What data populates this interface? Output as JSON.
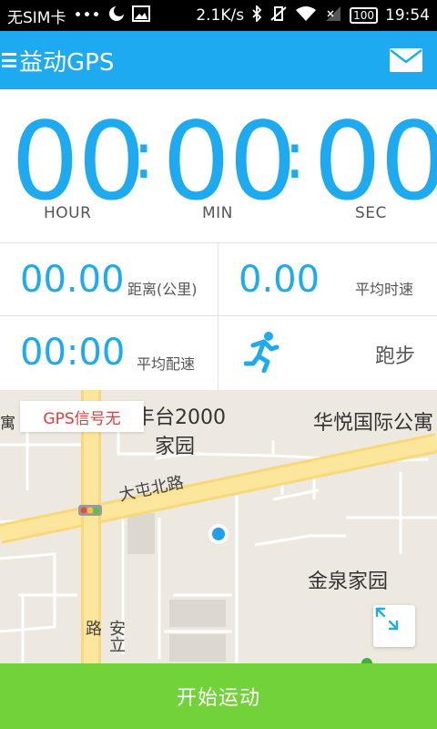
{
  "status_bar": {
    "carrier": "无SIM卡",
    "dots": "•••",
    "speed": "2.1K/s",
    "battery": "100",
    "time": "19:54"
  },
  "header": {
    "title": "益动GPS"
  },
  "timer": {
    "hours": "00",
    "minutes": "00",
    "seconds": "00",
    "separator": ":",
    "hour_label": "HOUR",
    "min_label": "MIN",
    "sec_label": "SEC"
  },
  "stats": {
    "distance_value": "00.00",
    "distance_label": "距离(公里)",
    "avg_speed_value": "0.00",
    "avg_speed_label": "平均时速",
    "pace_value": "00:00",
    "pace_label": "平均配速",
    "activity_label": "跑步"
  },
  "map": {
    "gps_status": "GPS信号无",
    "labels": {
      "poi_1_line1": "丰台2000",
      "poi_1_line2": "家园",
      "poi_2": "华悦国际公寓",
      "poi_3": "金泉家园",
      "road_1": "大屯北路",
      "road_2": "安立路",
      "edge": "寓"
    }
  },
  "footer": {
    "start_label": "开始运动"
  },
  "colors": {
    "accent": "#1eaaf1",
    "start_green": "#71d239",
    "gps_red": "#e23b3b"
  }
}
